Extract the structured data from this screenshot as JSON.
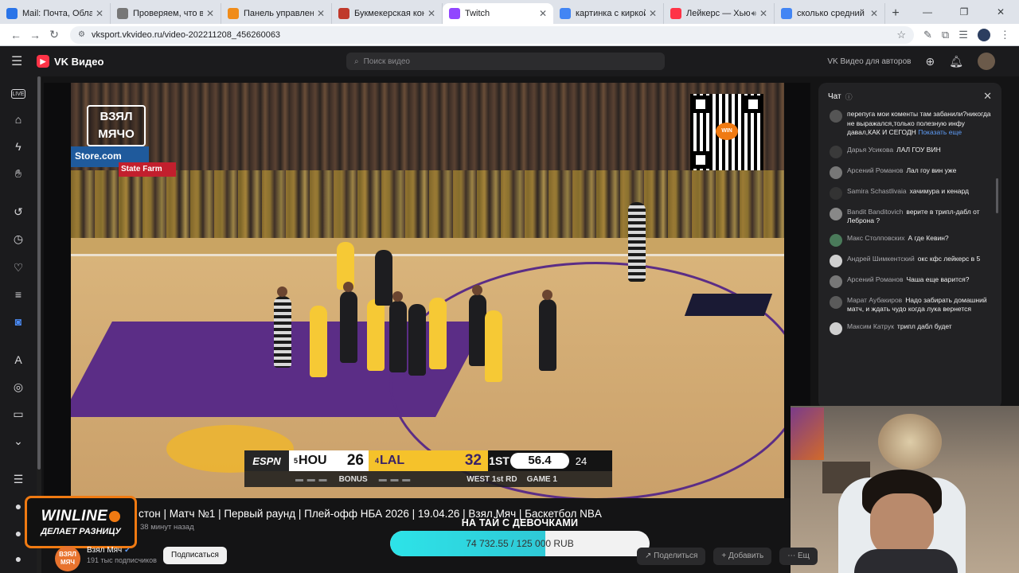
{
  "browser": {
    "tabs": [
      {
        "title": "Mail: Почта, Облако, Кал",
        "fav_color": "#2a74e8",
        "active": false
      },
      {
        "title": "Проверяем, что вы не р",
        "fav_color": "#777777",
        "active": false
      },
      {
        "title": "Панель управления - Do",
        "fav_color": "#f08c1a",
        "active": false
      },
      {
        "title": "Букмекерская контора Б",
        "fav_color": "#c0392b",
        "active": false
      },
      {
        "title": "Twitch",
        "fav_color": "#9146ff",
        "active": true
      },
      {
        "title": "картинка с киркой и алм",
        "fav_color": "#4285f4",
        "active": false
      },
      {
        "title": "Лейкерс — Хьюстон",
        "fav_color": "#ff3347",
        "active": false,
        "audio": true
      },
      {
        "title": "сколько средний рост в",
        "fav_color": "#4285f4",
        "active": false
      }
    ],
    "url": "vksport.vkvideo.ru/video-202211208_456260063"
  },
  "header": {
    "logo": "VK Видео",
    "search_placeholder": "Поиск видео",
    "for_authors": "VK Видео для авторов"
  },
  "player": {
    "watermark": "ВЗЯЛ МЯЧО",
    "qr_label": "WIN",
    "ads": [
      "Store.com",
      "State Farm"
    ],
    "scorebug": {
      "network": "ESPN",
      "away_seed": "5",
      "away_team": "HOU",
      "away_score": "26",
      "home_seed": "4",
      "home_team": "LAL",
      "home_score": "32",
      "quarter": "1ST",
      "clock": "56.4",
      "shot_clock": "24",
      "bonus": "BONUS",
      "series": "WEST 1st RD",
      "game": "GAME 1"
    }
  },
  "chat": {
    "title": "Чат",
    "messages": [
      {
        "author": "",
        "text": "перепуга мои коменты там забанили?никогда не выражался,только полезную инфу давал,КАК И СЕГОДН",
        "more": "Показать еще",
        "avatar": "#555555"
      },
      {
        "author": "Дарья Усикова",
        "text": "ЛАЛ ГОУ ВИН",
        "avatar": "#3a3a3a"
      },
      {
        "author": "Арсений Романов",
        "text": "Лал гоу вин уже",
        "avatar": "#777777"
      },
      {
        "author": "Samira Schastlivaia",
        "text": "хачимура и кенард",
        "avatar": "#333333"
      },
      {
        "author": "Bandit Banditovich",
        "text": "верите в трипл-дабл от Леброна ?",
        "avatar": "#888888"
      },
      {
        "author": "Макс Столповских",
        "text": "А где Кевин?",
        "avatar": "#4a7a5a"
      },
      {
        "author": "Андрей Шимкентский",
        "text": "окс кфс лейкерс в 5",
        "avatar": "#cfcfcf"
      },
      {
        "author": "Арсений Романов",
        "text": "Чаша еще варится?",
        "avatar": "#777777"
      },
      {
        "author": "Марат Аубакиров",
        "text": "Надо забирать домашний матч, и ждать чудо когда лука вернется",
        "avatar": "#5a5a5a"
      },
      {
        "author": "Максим Катрук",
        "text": "трипл дабл будет",
        "avatar": "#cfcfcf"
      }
    ]
  },
  "sponsor": {
    "name": "WINLINE",
    "slogan": "ДЕЛАЕТ РАЗНИЦУ"
  },
  "video": {
    "title": "стон | Матч №1 | Первый раунд | Плей-офф НБА 2026 | 19.04.26 | Взял Мяч | Баскетбол NBA",
    "meta": "38 минут назад",
    "channel": "Взял Мяч",
    "subscribers": "191 тыс подписчиков",
    "subscribe_label": "Подписаться",
    "share_label": "Поделиться",
    "add_label": "Добавить",
    "more_label": "Ещ"
  },
  "goal": {
    "label": "НА ТАЙ С ДЕВОЧКАМИ",
    "text": "74 732.55 / 125 000 RUB",
    "progress": 0.598
  }
}
